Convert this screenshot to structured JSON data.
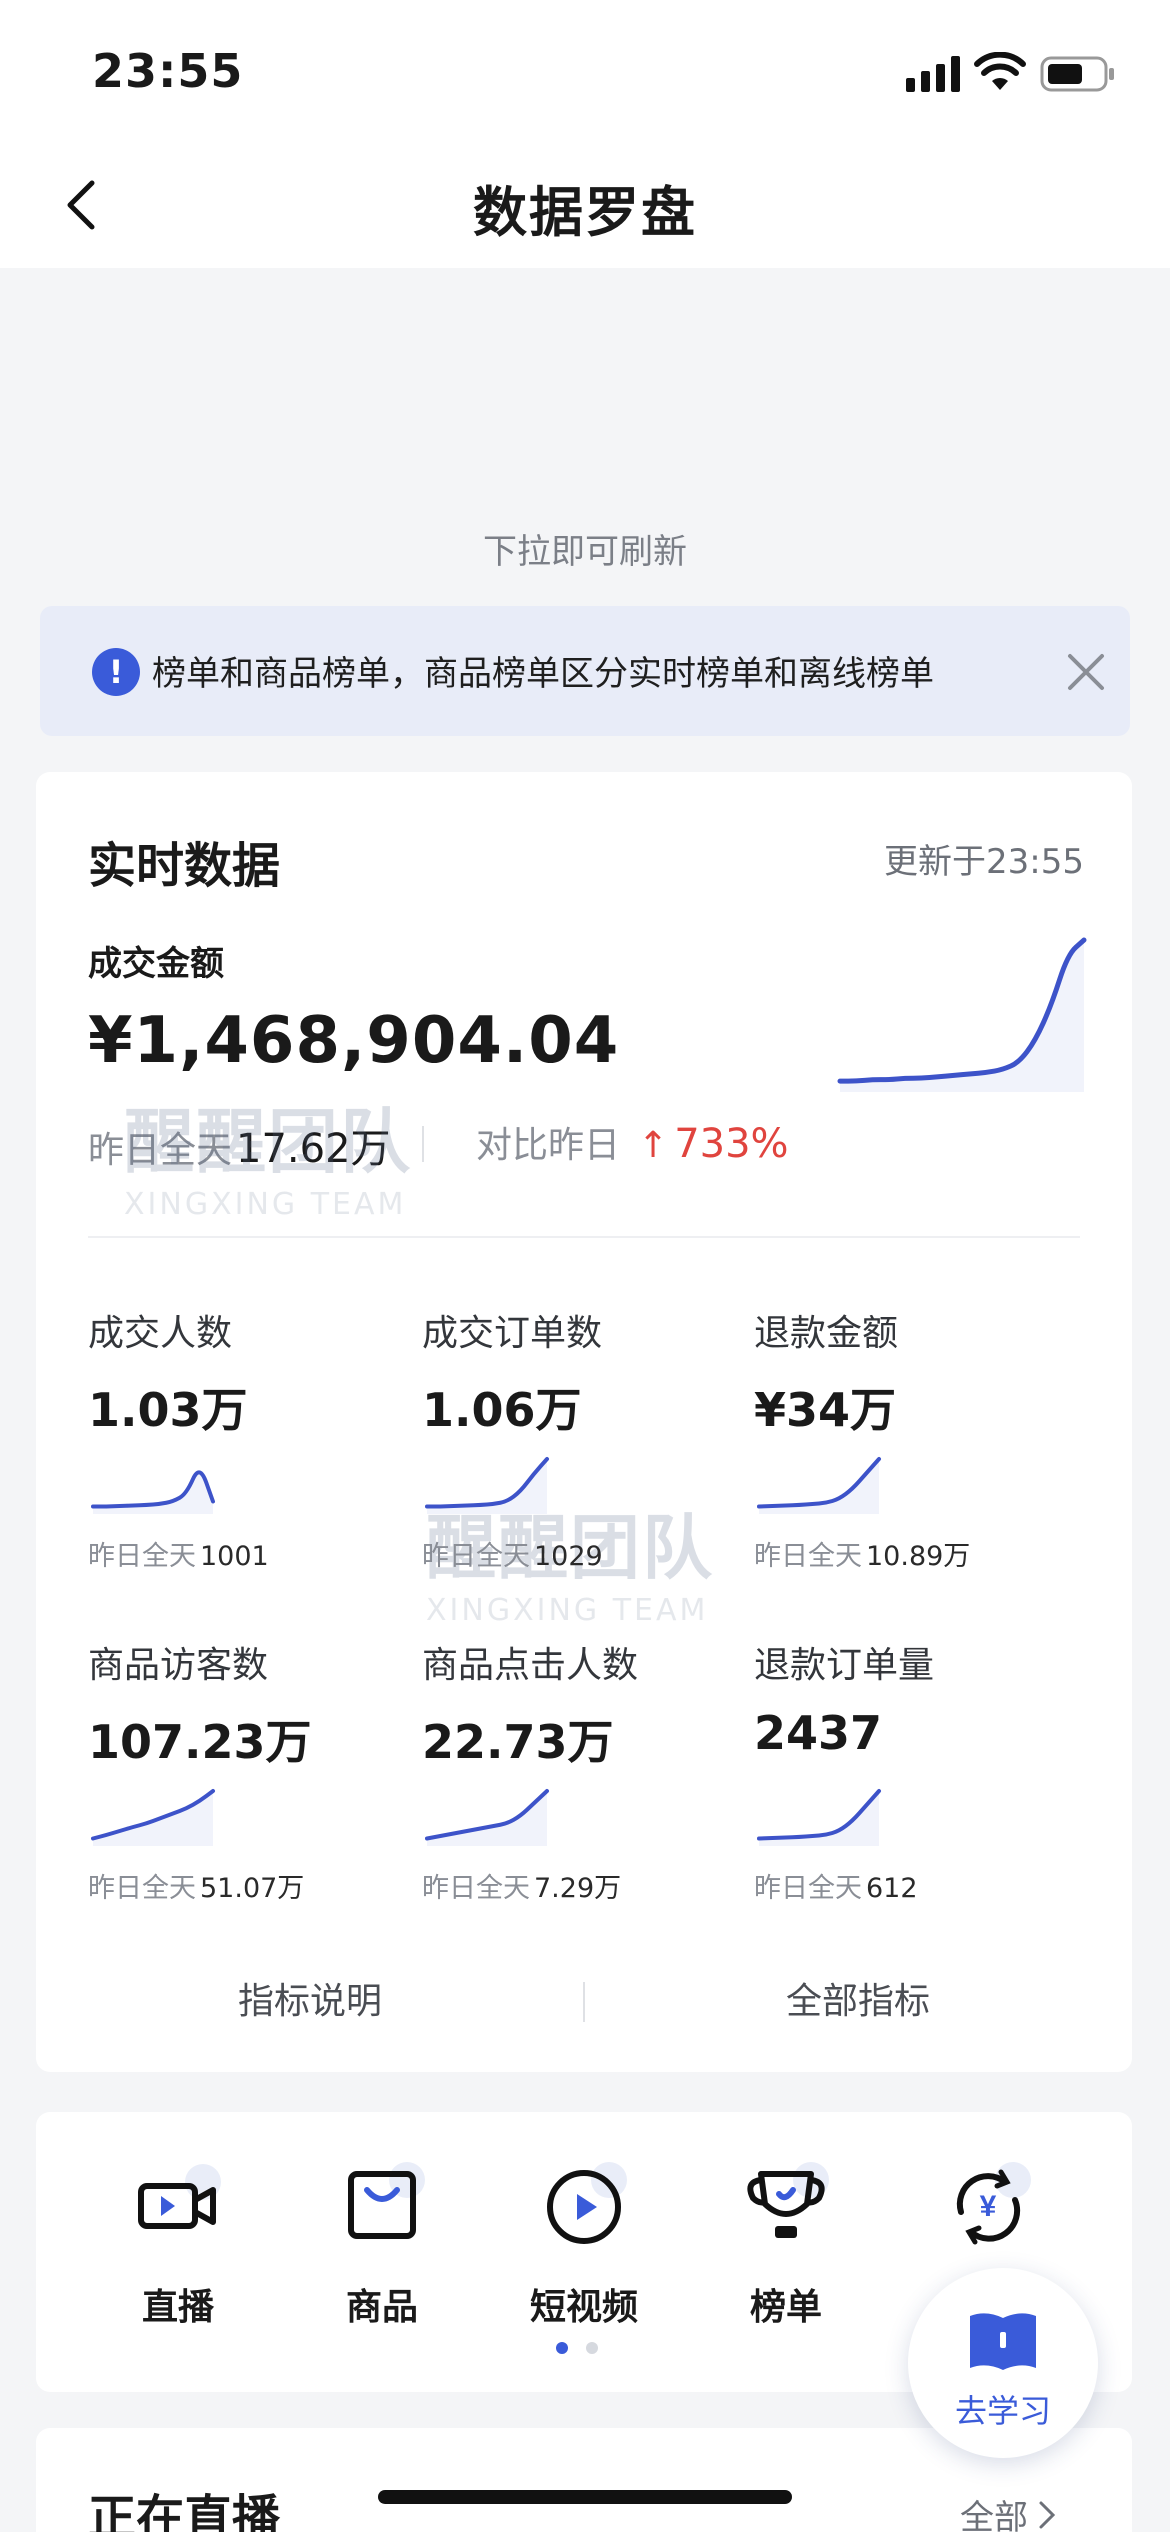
{
  "status_bar": {
    "time": "23:55"
  },
  "nav": {
    "title": "数据罗盘"
  },
  "refresh_hint": "下拉即可刷新",
  "notice": {
    "text": "榜单和商品榜单，商品榜单区分实时榜单和离线榜单"
  },
  "realtime": {
    "title": "实时数据",
    "updated": "更新于23:55",
    "gmv": {
      "label": "成交金额",
      "value": "¥1,468,904.04",
      "yesterday_label": "昨日全天",
      "yesterday_value": "17.62万",
      "compare_label": "对比昨日",
      "compare_value": "733",
      "compare_unit": "%",
      "trend": [
        0.02,
        0.02,
        0.03,
        0.03,
        0.04,
        0.04,
        0.05,
        0.06,
        0.07,
        0.08,
        0.1,
        0.15,
        0.3,
        0.55,
        0.9,
        1.0
      ]
    },
    "metrics": [
      {
        "label": "成交人数",
        "value": "1.03万",
        "yesterday_label": "昨日全天",
        "yesterday_value": "1001",
        "trend": [
          0.05,
          0.05,
          0.06,
          0.07,
          0.08,
          0.1,
          0.15,
          0.3,
          0.9,
          0.15
        ]
      },
      {
        "label": "成交订单数",
        "value": "1.06万",
        "yesterday_label": "昨日全天",
        "yesterday_value": "1029",
        "trend": [
          0.05,
          0.05,
          0.06,
          0.07,
          0.08,
          0.1,
          0.15,
          0.35,
          0.7,
          1.0
        ]
      },
      {
        "label": "退款金额",
        "value": "¥34万",
        "yesterday_label": "昨日全天",
        "yesterday_value": "10.89万",
        "trend": [
          0.05,
          0.06,
          0.07,
          0.08,
          0.1,
          0.12,
          0.2,
          0.4,
          0.7,
          1.0
        ]
      },
      {
        "label": "商品访客数",
        "value": "107.23万",
        "yesterday_label": "昨日全天",
        "yesterday_value": "51.07万",
        "trend": [
          0.05,
          0.12,
          0.2,
          0.28,
          0.35,
          0.45,
          0.55,
          0.65,
          0.8,
          1.0
        ]
      },
      {
        "label": "商品点击人数",
        "value": "22.73万",
        "yesterday_label": "昨日全天",
        "yesterday_value": "7.29万",
        "trend": [
          0.05,
          0.1,
          0.15,
          0.2,
          0.25,
          0.3,
          0.35,
          0.5,
          0.75,
          1.0
        ]
      },
      {
        "label": "退款订单量",
        "value": "2437",
        "yesterday_label": "昨日全天",
        "yesterday_value": "612",
        "trend": [
          0.05,
          0.06,
          0.07,
          0.08,
          0.1,
          0.12,
          0.2,
          0.4,
          0.7,
          1.0
        ]
      }
    ],
    "footer": {
      "left": "指标说明",
      "right": "全部指标"
    }
  },
  "watermark": {
    "cn": "醒醒团队",
    "en": "XINGXING TEAM"
  },
  "quick_nav": [
    {
      "label": "直播",
      "icon": "live-camera-icon"
    },
    {
      "label": "商品",
      "icon": "shopping-bag-icon"
    },
    {
      "label": "短视频",
      "icon": "play-circle-icon"
    },
    {
      "label": "榜单",
      "icon": "trophy-icon"
    },
    {
      "label": "",
      "icon": "yuan-cycle-icon"
    }
  ],
  "quick_nav_pages": {
    "count": 2,
    "active": 0
  },
  "live": {
    "title": "正在直播",
    "all": "全部"
  },
  "learn": {
    "label": "去学习"
  },
  "colors": {
    "accent": "#3a5bd9",
    "up": "#e0443e",
    "line": "#3d53c9"
  }
}
